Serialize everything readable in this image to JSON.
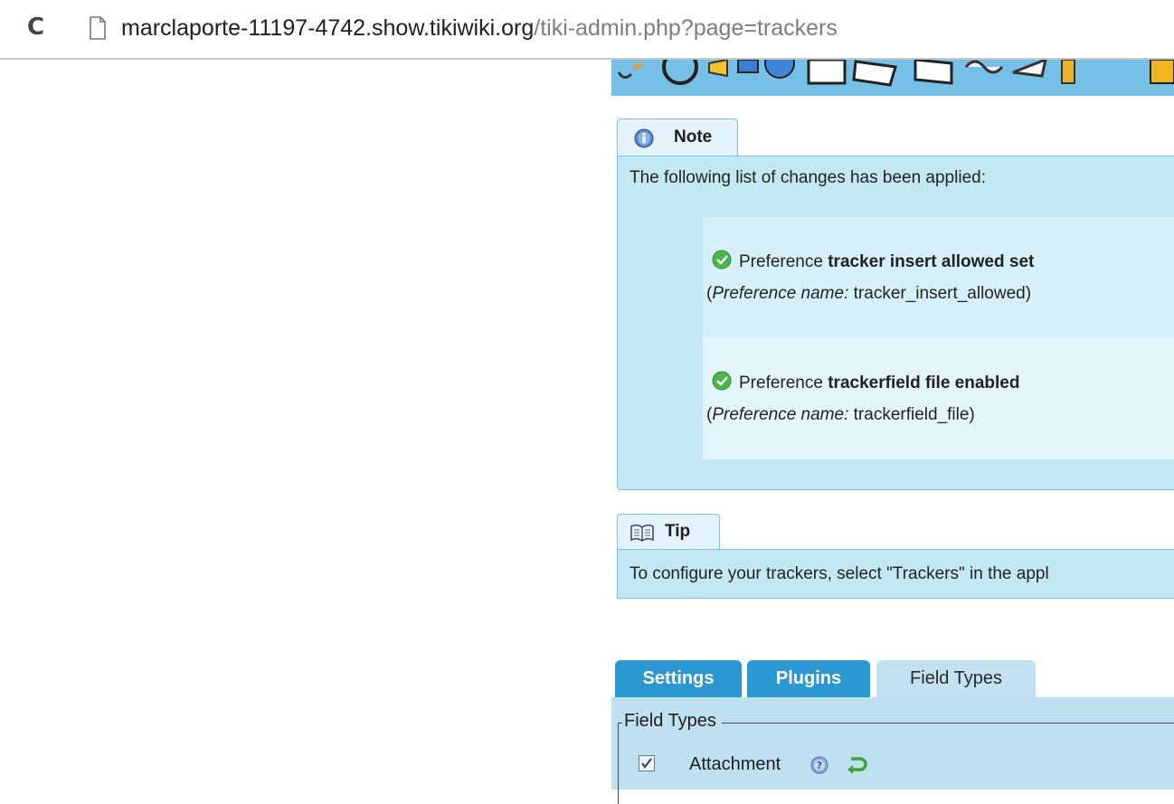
{
  "browser": {
    "url_host": "marclaporte-11197-4742.show.tikiwiki.org",
    "url_path": "/tiki-admin.php?page=trackers",
    "icons": [
      "reload-icon",
      "page-icon"
    ]
  },
  "note": {
    "title": "Note",
    "intro": "The following list of changes has been applied:",
    "changes": [
      {
        "prefix": "Preference",
        "name_bold": "tracker insert allowed set",
        "meta_label": "Preference name:",
        "meta_value": "tracker_insert_allowed"
      },
      {
        "prefix": "Preference",
        "name_bold": "trackerfield file enabled",
        "meta_label": "Preference name:",
        "meta_value": "trackerfield_file"
      }
    ]
  },
  "tip": {
    "title": "Tip",
    "text": "To configure your trackers, select \"Trackers\" in the appl"
  },
  "tabs": [
    {
      "label": "Settings",
      "active": false
    },
    {
      "label": "Plugins",
      "active": false
    },
    {
      "label": "Field Types",
      "active": true
    }
  ],
  "field_types": {
    "legend": "Field Types",
    "items": [
      {
        "label": "Attachment",
        "checked": true
      }
    ]
  },
  "colors": {
    "banner": "#76bfe6",
    "panel_bg": "#c3e8f4",
    "tab_active_blue": "#2b98d1",
    "success_green": "#4cb64a"
  }
}
